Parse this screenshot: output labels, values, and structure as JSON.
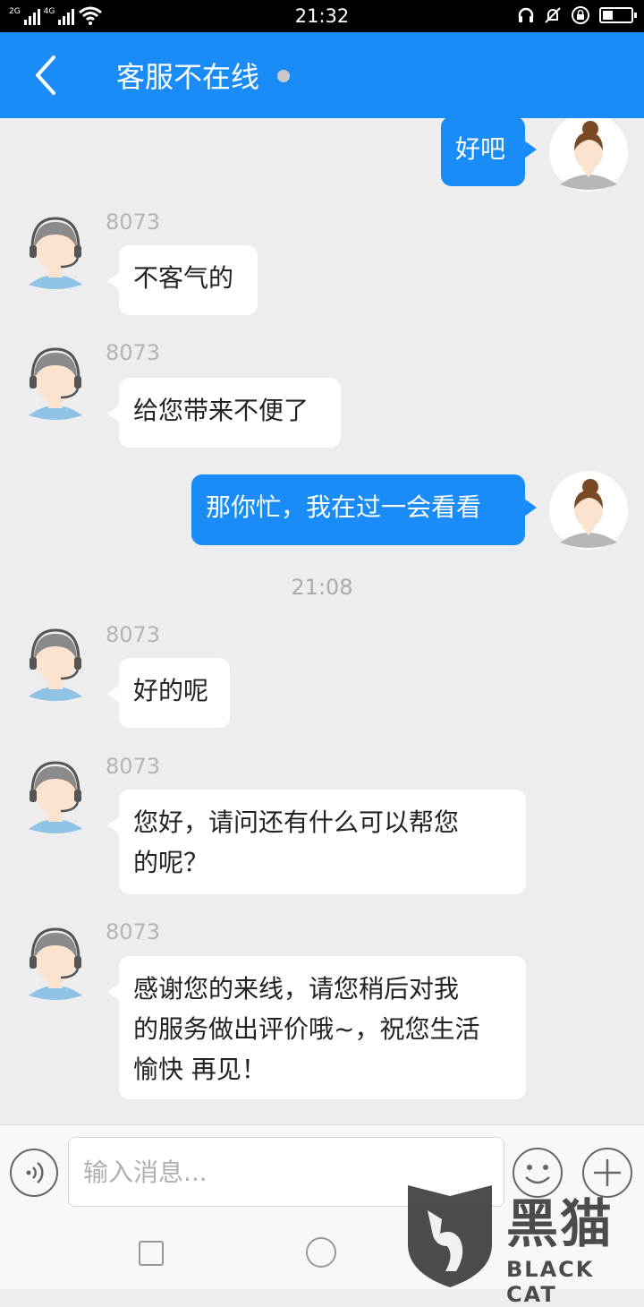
{
  "status_bar": {
    "network_1": "2G",
    "network_2": "4G",
    "time": "21:32",
    "battery_level": 0.35
  },
  "header": {
    "title": "客服不在线",
    "back_icon": "chevron-left-icon",
    "status_dot_color": "#c8c8c8"
  },
  "colors": {
    "accent": "#1a8cf7",
    "background": "#ededed"
  },
  "messages": [
    {
      "side": "user",
      "text": "好吧"
    },
    {
      "side": "agent",
      "sender": "8073",
      "text": "不客气的"
    },
    {
      "side": "agent",
      "sender": "8073",
      "text": "给您带来不便了"
    },
    {
      "side": "user",
      "text": "那你忙，我在过一会看看"
    },
    {
      "side": "time",
      "text": "21:08"
    },
    {
      "side": "agent",
      "sender": "8073",
      "text": "好的呢"
    },
    {
      "side": "agent",
      "sender": "8073",
      "line1": "您好，请问还有什么可以帮您",
      "line2": "的呢？"
    },
    {
      "side": "agent",
      "sender": "8073",
      "line1": "感谢您的来线，请您稍后对我",
      "line2": "的服务做出评价哦~，祝您生活",
      "line3": "愉快  再见！"
    }
  ],
  "input_bar": {
    "placeholder": "输入消息...",
    "value": "",
    "voice_icon": "voice-icon",
    "emoji_icon": "emoji-icon",
    "plus_icon": "plus-icon"
  },
  "watermark": {
    "title": "黑猫",
    "subtitle": "BLACK CAT"
  }
}
